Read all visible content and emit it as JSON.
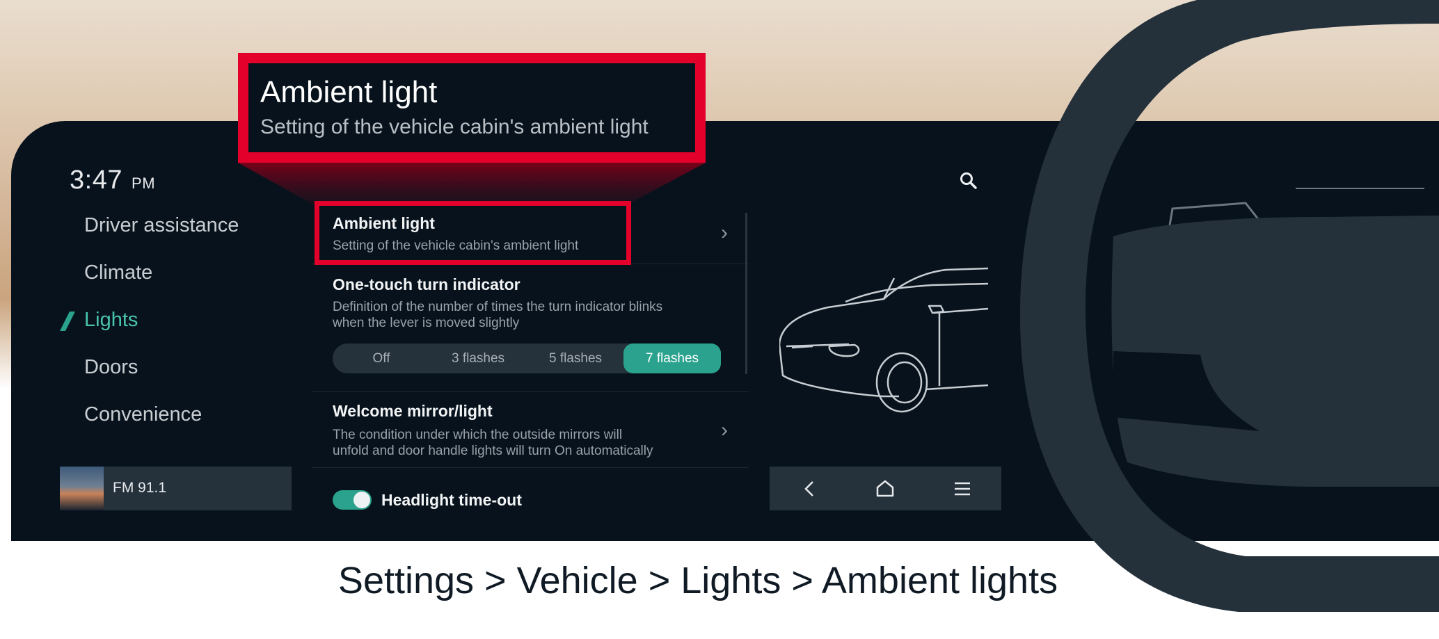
{
  "header": {
    "time": "3:47",
    "ampm": "PM"
  },
  "sidebar": {
    "items": [
      {
        "label": "Driver assistance",
        "active": false
      },
      {
        "label": "Climate",
        "active": false
      },
      {
        "label": "Lights",
        "active": true
      },
      {
        "label": "Doors",
        "active": false
      },
      {
        "label": "Convenience",
        "active": false
      }
    ]
  },
  "media": {
    "station": "FM 91.1"
  },
  "settings": {
    "ambient": {
      "title": "Ambient light",
      "desc": "Setting of the vehicle cabin's ambient light"
    },
    "turn_indicator": {
      "title": "One-touch turn indicator",
      "desc_line1": "Definition of the number of times the turn indicator blinks",
      "desc_line2": "when the lever is moved slightly",
      "options": [
        "Off",
        "3 flashes",
        "5 flashes",
        "7 flashes"
      ],
      "selected": "7 flashes"
    },
    "welcome": {
      "title": "Welcome mirror/light",
      "desc_line1": "The condition under which the outside mirrors will",
      "desc_line2": "unfold and door handle lights will turn On automatically"
    },
    "headlight": {
      "label": "Headlight time-out",
      "on": true
    }
  },
  "callout": {
    "title": "Ambient light",
    "subtitle": "Setting of the vehicle cabin's ambient light"
  },
  "breadcrumb": "Settings > Vehicle > Lights > Ambient lights",
  "icons": {
    "search": "search-icon",
    "back": "back-arrow-icon",
    "home": "home-icon",
    "menu": "menu-icon",
    "chevron": "chevron-right-icon"
  },
  "colors": {
    "accent": "#2aa28d",
    "active_nav": "#49c4ad",
    "highlight": "#e3002a",
    "screen_bg": "#07121c"
  }
}
